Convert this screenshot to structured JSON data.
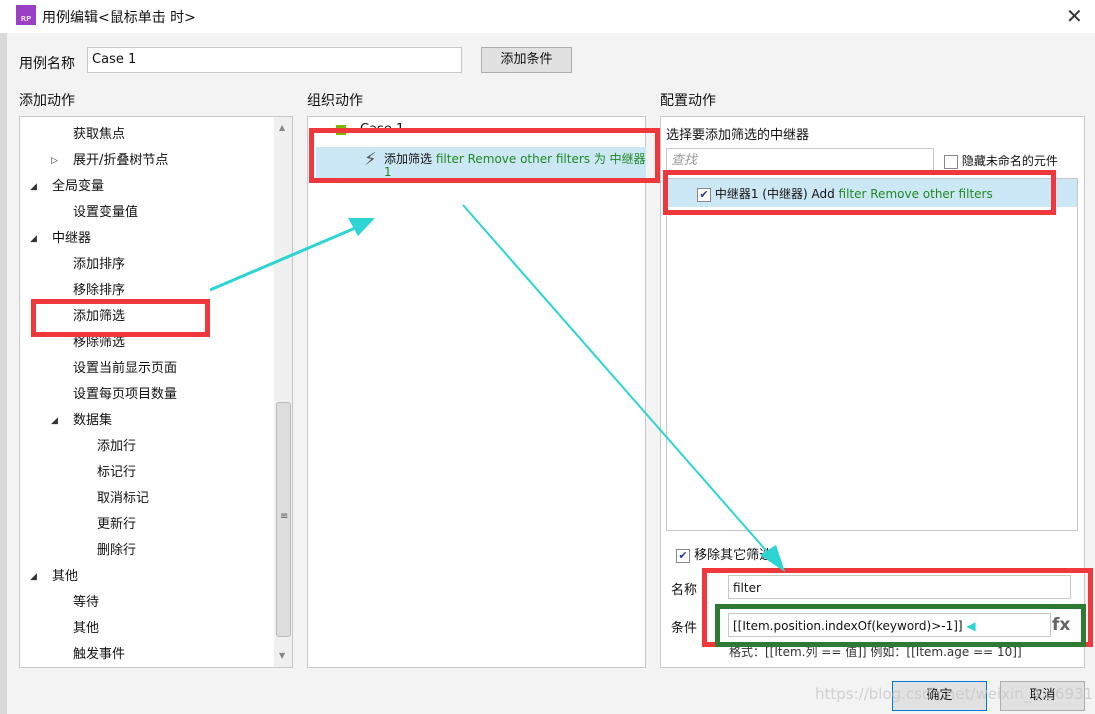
{
  "window": {
    "title": "用例编辑<鼠标单击 时>",
    "logo": "RP",
    "close_icon": "✕"
  },
  "case_name": {
    "label": "用例名称",
    "value": "Case 1",
    "add_condition": "添加条件"
  },
  "sections": {
    "add_action": "添加动作",
    "organize_action": "组织动作",
    "configure_action": "配置动作"
  },
  "tree": [
    {
      "label": "获取焦点",
      "level": 2,
      "toggle": ""
    },
    {
      "label": "展开/折叠树节点",
      "level": 2,
      "toggle": "▷"
    },
    {
      "label": "全局变量",
      "level": 1,
      "toggle": "◢"
    },
    {
      "label": "设置变量值",
      "level": 2,
      "toggle": ""
    },
    {
      "label": "中继器",
      "level": 1,
      "toggle": "◢"
    },
    {
      "label": "添加排序",
      "level": 2,
      "toggle": ""
    },
    {
      "label": "移除排序",
      "level": 2,
      "toggle": ""
    },
    {
      "label": "添加筛选",
      "level": 2,
      "toggle": ""
    },
    {
      "label": "移除筛选",
      "level": 2,
      "toggle": ""
    },
    {
      "label": "设置当前显示页面",
      "level": 2,
      "toggle": ""
    },
    {
      "label": "设置每页项目数量",
      "level": 2,
      "toggle": ""
    },
    {
      "label": "数据集",
      "level": 2,
      "toggle": "◢"
    },
    {
      "label": "添加行",
      "level": 3,
      "toggle": ""
    },
    {
      "label": "标记行",
      "level": 3,
      "toggle": ""
    },
    {
      "label": "取消标记",
      "level": 3,
      "toggle": ""
    },
    {
      "label": "更新行",
      "level": 3,
      "toggle": ""
    },
    {
      "label": "删除行",
      "level": 3,
      "toggle": ""
    },
    {
      "label": "其他",
      "level": 1,
      "toggle": "◢"
    },
    {
      "label": "等待",
      "level": 2,
      "toggle": ""
    },
    {
      "label": "其他",
      "level": 2,
      "toggle": ""
    },
    {
      "label": "触发事件",
      "level": 2,
      "toggle": ""
    }
  ],
  "organize": {
    "case": "Case 1",
    "action_prefix": "添加筛选",
    "action_detail": "filter Remove other filters 为 中继器",
    "action_detail2": "1"
  },
  "configure": {
    "select_label": "选择要添加筛选的中继器",
    "search_placeholder": "查找",
    "hide_unnamed": "隐藏未命名的元件",
    "repeater_item": "中继器1 (中继器) Add",
    "repeater_item_green": "filter Remove other filters",
    "remove_others": "移除其它筛选",
    "name_label": "名称",
    "name_value": "filter",
    "condition_label": "条件",
    "condition_value": "[[Item.position.indexOf(keyword)>-1]]",
    "fx": "fx",
    "hint": "格式：[[Item.列 == 值]] 例如：[[Item.age == 10]]"
  },
  "footer": {
    "ok": "确定",
    "cancel": "取消",
    "watermark": "https://blog.csdn.net/weixin_4...6931"
  }
}
